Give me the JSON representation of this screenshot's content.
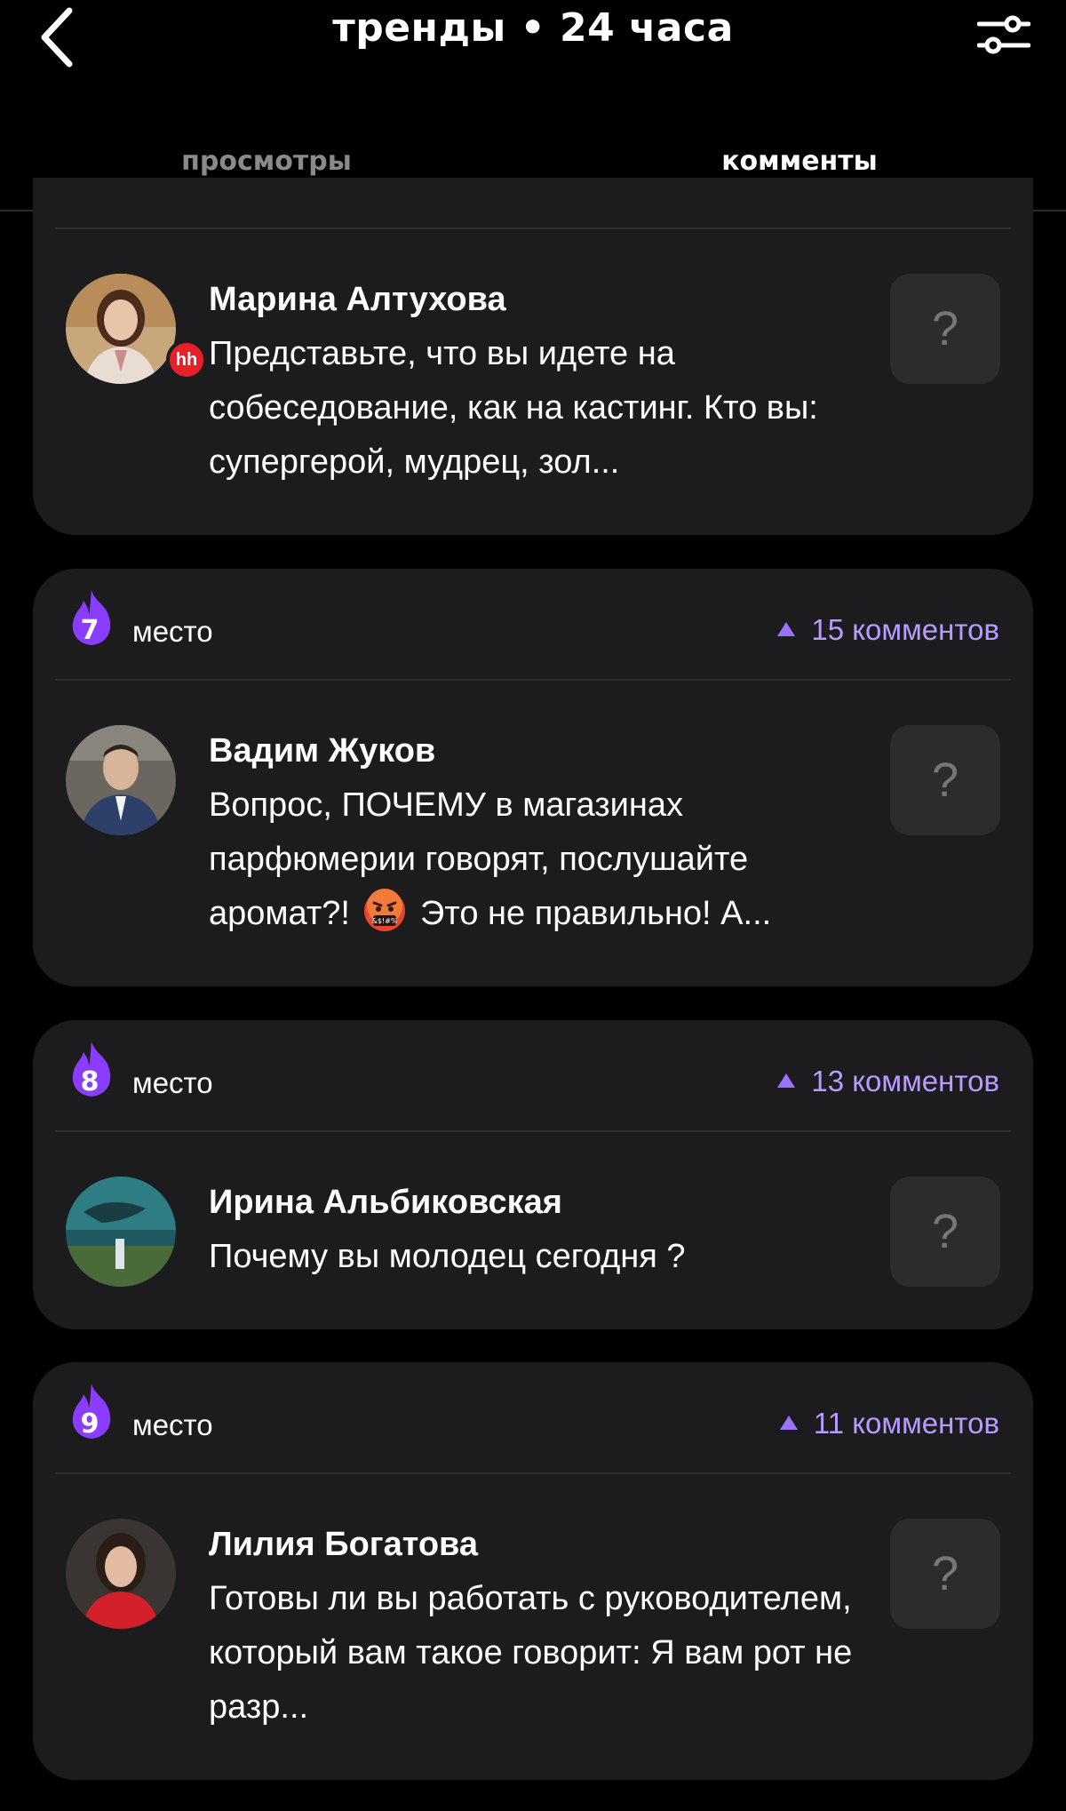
{
  "header": {
    "title": "тренды • 24 часа"
  },
  "tabs": [
    {
      "label": "просмотры",
      "active": false
    },
    {
      "label": "комменты",
      "active": true
    }
  ],
  "colors": {
    "accent": "#9a73ff",
    "count_text": "#b79cff",
    "card_bg": "#1c1c1e",
    "badge_red": "#e8202a"
  },
  "cards": [
    {
      "author": "Марина Алтухова",
      "text": "Представьте, что вы идете на собеседование, как на кастинг. Кто вы: супергерой, мудрец, зол...",
      "badge": "hh",
      "action": "?"
    },
    {
      "place": "7",
      "place_label": "место",
      "count": "15 комментов",
      "author": "Вадим Жуков",
      "text_before": "Вопрос, ПОЧЕМУ в магазинах парфюмерии говорят, послушайте аромат?!",
      "emoji": "angry-face-with-symbols",
      "text_after": "Это не правильно! А...",
      "action": "?"
    },
    {
      "place": "8",
      "place_label": "место",
      "count": "13 комментов",
      "author": "Ирина Альбиковская",
      "text": "Почему вы молодец сегодня ?",
      "action": "?"
    },
    {
      "place": "9",
      "place_label": "место",
      "count": "11 комментов",
      "author": "Лилия Богатова",
      "text": "Готовы ли вы работать с руководителем, который вам такое говорит: Я вам рот не разр...",
      "action": "?"
    }
  ]
}
